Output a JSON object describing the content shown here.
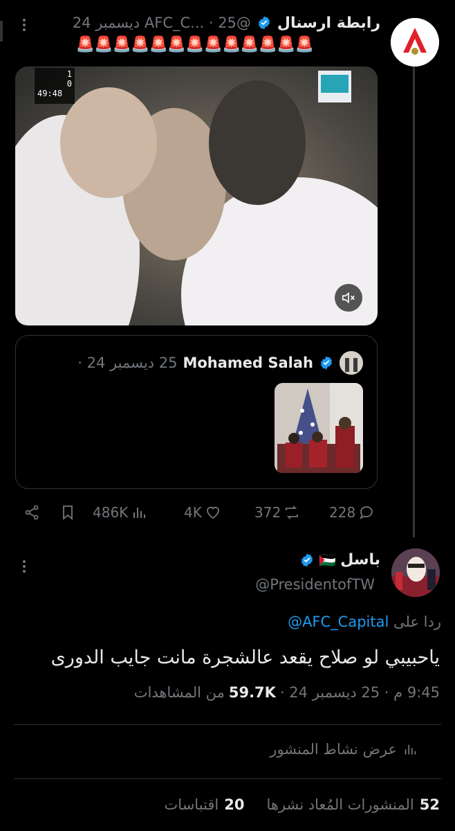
{
  "tweet": {
    "author_name": "رابطة ارسنال",
    "handle_date": "@AFC_C... · 25 ديسمبر 24",
    "text": "🚨🚨🚨🚨🚨🚨🚨🚨🚨🚨🚨🚨🚨",
    "video": {
      "score_a": "1",
      "score_b": "0",
      "clock": "49:48"
    },
    "quote": {
      "author_name": "Mohamed Salah",
      "date": "25 ديسمبر 24 ·"
    },
    "actions": {
      "replies": "228",
      "reposts": "372",
      "likes": "4K",
      "views": "486K"
    }
  },
  "reply": {
    "author_name": "باسل",
    "flag": "🇵🇸",
    "handle": "@PresidentofTW",
    "replying_prefix": "ردا على",
    "replying_to": "@AFC_Capital",
    "text": "ياحبيبي لو صلاح يقعد عالشجرة مانت جايب الدورى",
    "time_date": "9:45 م · 25 ديسمبر 24 ·",
    "views_count": "59.7K",
    "views_label": "من المشاهدات",
    "activity_label": "عرض نشاط المنشور",
    "reposts_count": "52",
    "reposts_label": "المنشورات المُعاد نشرها",
    "quotes_count": "20",
    "quotes_label": "اقتباسات"
  },
  "colors": {
    "background": "#000000",
    "text": "#e7e9ea",
    "muted": "#71767b",
    "verified": "#1d9bf0",
    "link": "#1d9bf0",
    "border": "#2f3336"
  }
}
